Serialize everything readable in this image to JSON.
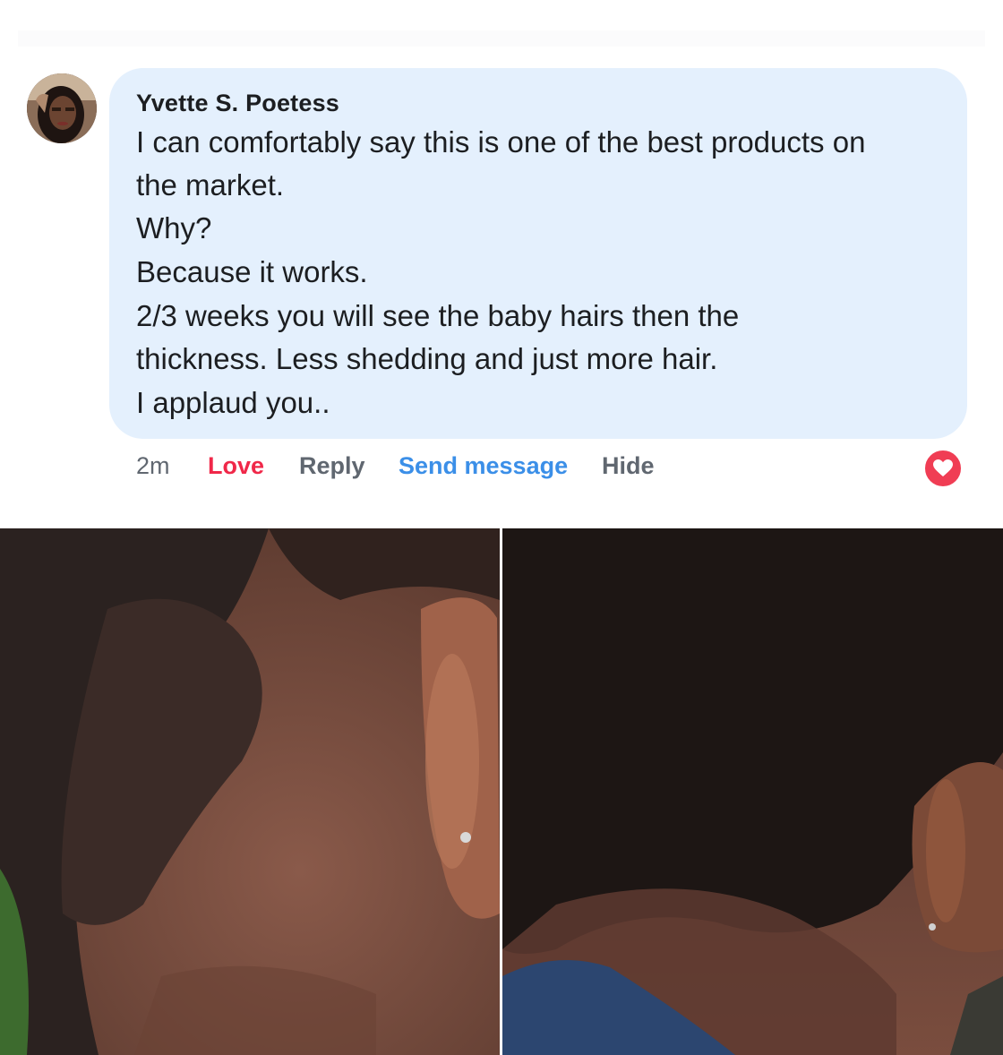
{
  "comment": {
    "author": "Yvette S. Poetess",
    "lines": [
      "I can comfortably say this is one of the best products on",
      "the market.",
      "Why?",
      "Because it works.",
      "2/3 weeks you will see the baby hairs then the",
      "thickness. Less shedding and just more hair.",
      "I applaud you.."
    ]
  },
  "actions": {
    "time": "2m",
    "love": "Love",
    "reply": "Reply",
    "send_message": "Send message",
    "hide": "Hide"
  },
  "reaction": {
    "icon": "heart-icon",
    "color": "#f03d54"
  },
  "colors": {
    "bubble": "#e4f0fd",
    "love": "#f02849",
    "link": "#3b8fe8",
    "muted": "#606770"
  }
}
